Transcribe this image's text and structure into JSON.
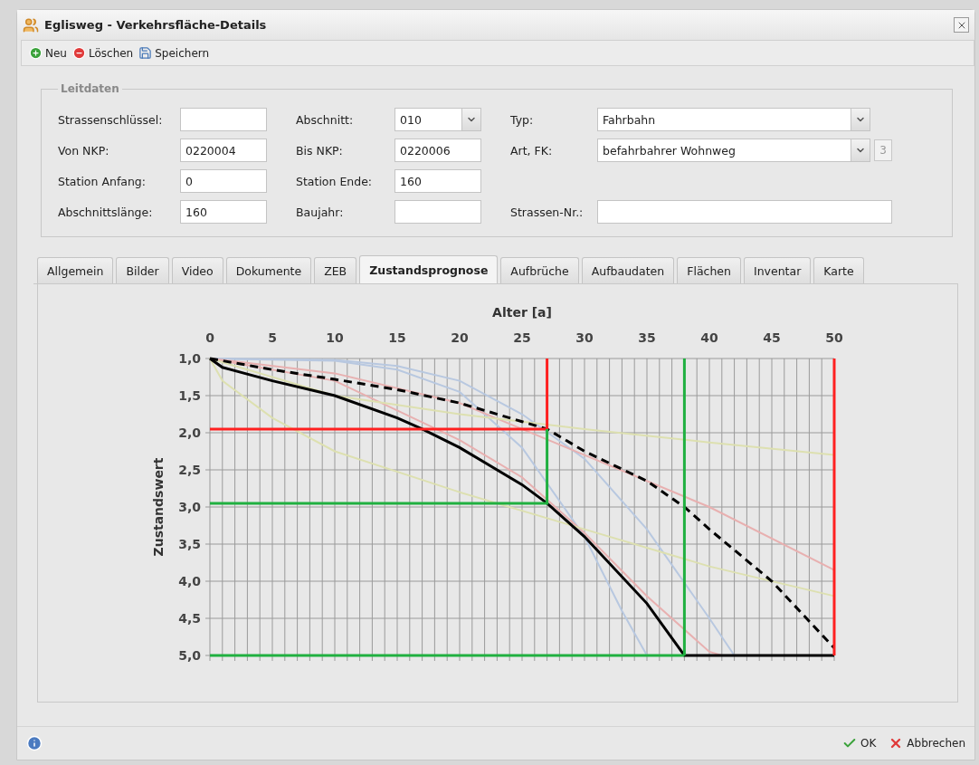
{
  "window": {
    "title": "Eglisweg - Verkehrsfläche-Details"
  },
  "toolbar": [
    {
      "label": "Neu",
      "kind": "add"
    },
    {
      "label": "Löschen",
      "kind": "delete"
    },
    {
      "label": "Speichern",
      "kind": "save"
    }
  ],
  "leitdaten": {
    "legend": "Leitdaten",
    "rows": [
      [
        {
          "label": "Strassenschlüssel:",
          "kind": "text"
        },
        {
          "label": "Abschnitt:",
          "kind": "combo",
          "value": "010"
        },
        {
          "label": "Typ:",
          "kind": "combo",
          "value": "Fahrbahn"
        }
      ],
      [
        {
          "label": "Von NKP:",
          "kind": "text",
          "value": "0220004"
        },
        {
          "label": "Bis NKP:",
          "kind": "text",
          "value": "0220006"
        },
        {
          "label": "Art, FK:",
          "kind": "combo",
          "value": "befahrbahrer Wohnweg",
          "badge": "3"
        }
      ],
      [
        {
          "label": "Station Anfang:",
          "kind": "text",
          "value": "0"
        },
        {
          "label": "Station Ende:",
          "kind": "text",
          "value": "160"
        },
        null
      ],
      [
        {
          "label": "Abschnittslänge:",
          "kind": "text",
          "value": "160"
        },
        {
          "label": "Baujahr:",
          "kind": "text"
        },
        {
          "label": "Strassen-Nr.:",
          "kind": "text"
        }
      ]
    ]
  },
  "tabs": [
    {
      "label": "Allgemein",
      "selected": false
    },
    {
      "label": "Bilder",
      "selected": false
    },
    {
      "label": "Video",
      "selected": false
    },
    {
      "label": "Dokumente",
      "selected": false
    },
    {
      "label": "ZEB",
      "selected": false
    },
    {
      "label": "Zustandsprognose",
      "selected": true
    },
    {
      "label": "Aufbrüche",
      "selected": false
    },
    {
      "label": "Aufbaudaten",
      "selected": false
    },
    {
      "label": "Flächen",
      "selected": false
    },
    {
      "label": "Inventar",
      "selected": false
    },
    {
      "label": "Karte",
      "selected": false
    }
  ],
  "chart_data": {
    "type": "line",
    "xlabel": "Alter [a]",
    "ylabel": "Zustandswert",
    "xlim": [
      0,
      50
    ],
    "ylim": [
      5,
      1
    ],
    "grid": true,
    "xticks": [
      0,
      5,
      10,
      15,
      20,
      25,
      30,
      35,
      40,
      45,
      50
    ],
    "yticks": [
      {
        "value": 1,
        "label": "1,0"
      },
      {
        "value": 1.5,
        "label": "1,5"
      },
      {
        "value": 2,
        "label": "2,0"
      },
      {
        "value": 2.5,
        "label": "2,5"
      },
      {
        "value": 3,
        "label": "3,0"
      },
      {
        "value": 3.5,
        "label": "3,5"
      },
      {
        "value": 4,
        "label": "4,0"
      },
      {
        "value": 4.5,
        "label": "4,5"
      },
      {
        "value": 5,
        "label": "5,0"
      }
    ],
    "series": [
      {
        "color": "#b8c8e0",
        "line_style": "solid",
        "x": [
          0,
          10,
          15,
          20,
          25,
          30,
          33,
          35
        ],
        "values": [
          1,
          1.03,
          1.15,
          1.45,
          2.2,
          3.4,
          4.4,
          5
        ]
      },
      {
        "color": "#b8c8e0",
        "line_style": "solid",
        "x": [
          0,
          10,
          15,
          20,
          25,
          30,
          35,
          40,
          42
        ],
        "values": [
          1,
          1.02,
          1.1,
          1.3,
          1.75,
          2.35,
          3.3,
          4.5,
          5
        ]
      },
      {
        "color": "#e8b0b0",
        "line_style": "solid",
        "x": [
          0,
          10,
          20,
          25,
          30,
          35,
          40,
          41
        ],
        "values": [
          1,
          1.3,
          2.1,
          2.6,
          3.35,
          4.2,
          4.95,
          5
        ]
      },
      {
        "color": "#e8b0b0",
        "line_style": "solid",
        "x": [
          0,
          10,
          20,
          30,
          40,
          50
        ],
        "values": [
          1,
          1.2,
          1.6,
          2.3,
          3.0,
          3.85
        ]
      },
      {
        "color": "#dde0b0",
        "line_style": "solid",
        "x": [
          0,
          1,
          5,
          10,
          20,
          30,
          40,
          50
        ],
        "values": [
          1,
          1.3,
          1.8,
          2.25,
          2.8,
          3.3,
          3.8,
          4.2
        ]
      },
      {
        "color": "#dde0b0",
        "line_style": "solid",
        "x": [
          0,
          10,
          20,
          30,
          40,
          50
        ],
        "values": [
          1,
          1.5,
          1.75,
          1.95,
          2.13,
          2.3
        ]
      },
      {
        "color": "#000000",
        "line_style": "solid",
        "x": [
          0,
          1,
          5,
          10,
          15,
          17,
          20,
          25,
          27,
          30,
          35,
          38,
          50
        ],
        "values": [
          1,
          1.12,
          1.3,
          1.5,
          1.8,
          1.95,
          2.2,
          2.7,
          2.95,
          3.4,
          4.3,
          5,
          5
        ]
      },
      {
        "color": "#000000",
        "line_style": "dashed",
        "x": [
          0,
          5,
          10,
          15,
          20,
          25,
          27,
          30,
          35,
          38,
          40,
          45,
          50
        ],
        "values": [
          1,
          1.15,
          1.28,
          1.42,
          1.6,
          1.85,
          1.95,
          2.25,
          2.65,
          3,
          3.3,
          4,
          4.9
        ]
      },
      {
        "color": "#ff2020",
        "line_style": "solid",
        "x": [
          0,
          27,
          27
        ],
        "values": [
          1.95,
          1.95,
          1
        ]
      },
      {
        "color": "#20b040",
        "line_style": "solid",
        "x": [
          0,
          27,
          27
        ],
        "values": [
          2.95,
          2.95,
          1.95
        ]
      },
      {
        "color": "#20b040",
        "line_style": "solid",
        "x": [
          0,
          38
        ],
        "values": [
          5,
          5
        ]
      }
    ],
    "ref_lines": [
      {
        "axis": "x",
        "value": 50,
        "color": "#ff2020"
      },
      {
        "axis": "x",
        "value": 38,
        "color": "#20b040"
      }
    ]
  },
  "footer": {
    "buttons": [
      {
        "label": "OK",
        "kind": "ok"
      },
      {
        "label": "Abbrechen",
        "kind": "cancel"
      }
    ]
  }
}
